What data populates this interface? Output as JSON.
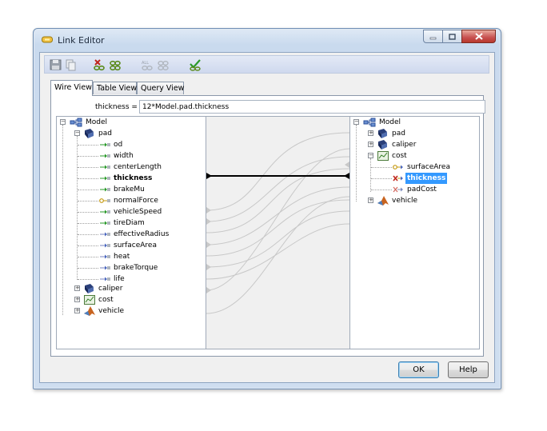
{
  "window": {
    "title": "Link Editor"
  },
  "caption_buttons": {
    "minimize": "minimize",
    "maximize": "maximize",
    "close": "close"
  },
  "toolbar": {
    "buttons": [
      "save-icon",
      "copy-icon",
      "unlink-icon",
      "link-icon",
      "unlink-all-icon",
      "link-all-icon",
      "validate-icon"
    ]
  },
  "tabs": [
    {
      "label": "Wire View",
      "active": true
    },
    {
      "label": "Table View",
      "active": false
    },
    {
      "label": "Query View",
      "active": false
    }
  ],
  "expression": {
    "label": "thickness =",
    "value": "12*Model.pad.thickness"
  },
  "left_tree": {
    "root": "Model",
    "pad": "pad",
    "pad_children": [
      "od",
      "width",
      "centerLength",
      "thickness",
      "brakeMu",
      "normalForce",
      "vehicleSpeed",
      "tireDiam",
      "effectiveRadius",
      "surfaceArea",
      "heat",
      "brakeTorque",
      "life"
    ],
    "siblings": [
      "caliper",
      "cost",
      "vehicle"
    ]
  },
  "right_tree": {
    "root": "Model",
    "nodes": [
      "pad",
      "caliper",
      "cost"
    ],
    "cost_children": [
      "surfaceArea",
      "thickness",
      "padCost"
    ],
    "last": "vehicle"
  },
  "buttons": {
    "ok": "OK",
    "help": "Help"
  },
  "colors": {
    "selection": "#3399ff",
    "wire": "#c8c8c8",
    "active_wire": "#000000"
  }
}
